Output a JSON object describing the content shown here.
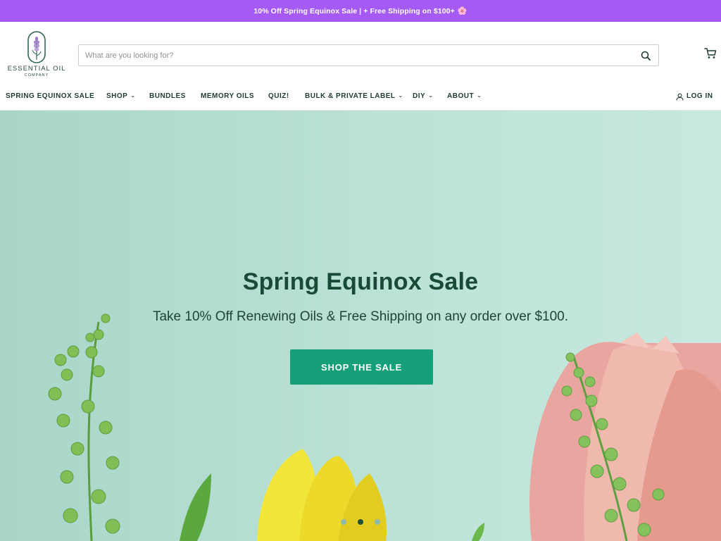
{
  "announcement": {
    "text": "10% Off Spring Equinox Sale | + Free Shipping on $100+",
    "emoji": "🌸",
    "bg_color": "#a55af4"
  },
  "logo": {
    "name": "ESSENTIAL OIL",
    "sub": "COMPANY"
  },
  "search": {
    "placeholder": "What are you looking for?",
    "value": "",
    "icon": "search-icon"
  },
  "cart": {
    "icon": "cart-icon"
  },
  "nav": {
    "items": [
      {
        "label": "SPRING EQUINOX SALE",
        "has_dropdown": false
      },
      {
        "label": "SHOP",
        "has_dropdown": true
      },
      {
        "label": "BUNDLES",
        "has_dropdown": false
      },
      {
        "label": "MEMORY OILS",
        "has_dropdown": false
      },
      {
        "label": "QUIZ!",
        "has_dropdown": false
      },
      {
        "label": "BULK & PRIVATE LABEL",
        "has_dropdown": true
      },
      {
        "label": "DIY",
        "has_dropdown": true
      },
      {
        "label": "ABOUT",
        "has_dropdown": true
      }
    ],
    "chevron": "⌄",
    "login_label": "LOG IN",
    "login_icon": "user-icon"
  },
  "hero": {
    "title": "Spring Equinox Sale",
    "subtitle": "Take 10% Off Renewing Oils & Free Shipping on any order over $100.",
    "button_label": "SHOP THE SALE",
    "button_color": "#16a07a",
    "slide_count": 3,
    "active_slide": 2
  }
}
